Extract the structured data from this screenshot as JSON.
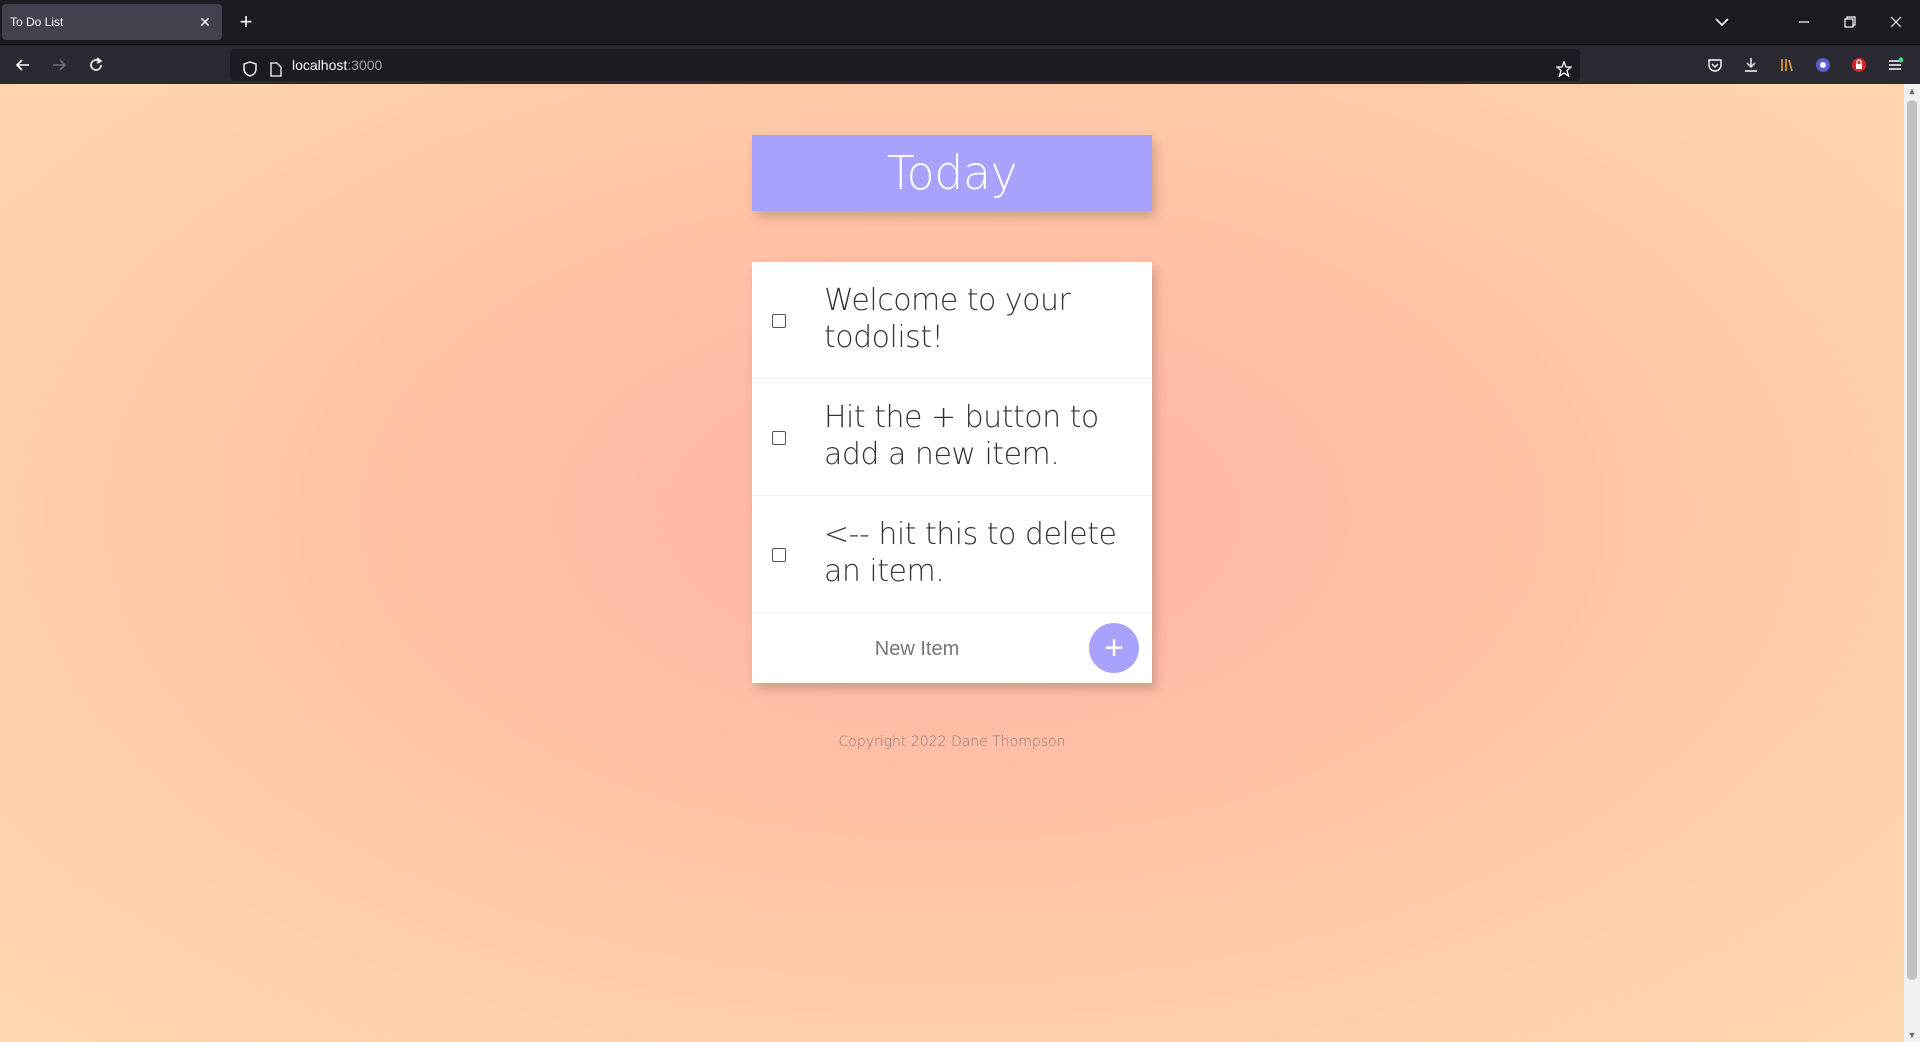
{
  "browser": {
    "tab_title": "To Do List",
    "url_host": "localhost",
    "url_port": ":3000"
  },
  "page": {
    "heading": "Today",
    "items": [
      {
        "text": "Welcome to your todolist!"
      },
      {
        "text": "Hit the + button to add a new item."
      },
      {
        "text": "<-- hit this to delete an item."
      }
    ],
    "new_item_placeholder": "New Item",
    "add_button_label": "+",
    "footer": "Copyright 2022 Dane Thompson"
  },
  "colors": {
    "accent": "#a8a2fc",
    "background_center": "#ffb3a7",
    "background_edge": "#ffd6af"
  }
}
